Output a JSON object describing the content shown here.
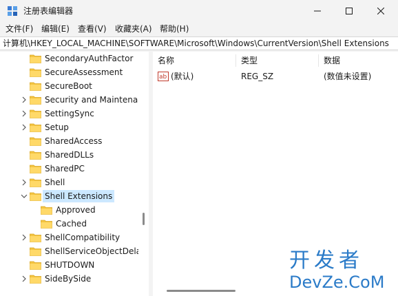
{
  "window": {
    "title": "注册表编辑器",
    "icons": [
      "registry-editor-icon",
      "minimize-icon",
      "maximize-icon",
      "close-icon"
    ]
  },
  "menu": {
    "items": [
      {
        "label": "文件(F)"
      },
      {
        "label": "编辑(E)"
      },
      {
        "label": "查看(V)"
      },
      {
        "label": "收藏夹(A)"
      },
      {
        "label": "帮助(H)"
      }
    ]
  },
  "address": {
    "path": "计算机\\HKEY_LOCAL_MACHINE\\SOFTWARE\\Microsoft\\Windows\\CurrentVersion\\Shell Extensions"
  },
  "tree": {
    "items": [
      {
        "label": "SecondaryAuthFactor",
        "level": 0,
        "expander": "none",
        "selected": false
      },
      {
        "label": "SecureAssessment",
        "level": 0,
        "expander": "none",
        "selected": false
      },
      {
        "label": "SecureBoot",
        "level": 0,
        "expander": "none",
        "selected": false
      },
      {
        "label": "Security and Maintenance",
        "level": 0,
        "expander": "collapsed",
        "selected": false
      },
      {
        "label": "SettingSync",
        "level": 0,
        "expander": "collapsed",
        "selected": false
      },
      {
        "label": "Setup",
        "level": 0,
        "expander": "collapsed",
        "selected": false
      },
      {
        "label": "SharedAccess",
        "level": 0,
        "expander": "none",
        "selected": false
      },
      {
        "label": "SharedDLLs",
        "level": 0,
        "expander": "none",
        "selected": false
      },
      {
        "label": "SharedPC",
        "level": 0,
        "expander": "none",
        "selected": false
      },
      {
        "label": "Shell",
        "level": 0,
        "expander": "collapsed",
        "selected": false
      },
      {
        "label": "Shell Extensions",
        "level": 0,
        "expander": "expanded",
        "selected": true
      },
      {
        "label": "Approved",
        "level": 1,
        "expander": "none",
        "selected": false
      },
      {
        "label": "Cached",
        "level": 1,
        "expander": "none",
        "selected": false
      },
      {
        "label": "ShellCompatibility",
        "level": 0,
        "expander": "collapsed",
        "selected": false
      },
      {
        "label": "ShellServiceObjectDelayLoad",
        "level": 0,
        "expander": "none",
        "selected": false
      },
      {
        "label": "SHUTDOWN",
        "level": 0,
        "expander": "none",
        "selected": false
      },
      {
        "label": "SideBySide",
        "level": 0,
        "expander": "collapsed",
        "selected": false
      }
    ]
  },
  "list": {
    "columns": [
      {
        "label": "名称"
      },
      {
        "label": "类型"
      },
      {
        "label": "数据"
      }
    ],
    "rows": [
      {
        "name": "(默认)",
        "type": "REG_SZ",
        "data": "(数值未设置)",
        "icon": "string-value-icon"
      }
    ]
  },
  "watermark": {
    "top": "开发者",
    "bottom": "DevZe.CoM"
  },
  "colors": {
    "selection": "#cce8ff",
    "folder": "#f4c542",
    "watermark": "#2b7bc8"
  }
}
